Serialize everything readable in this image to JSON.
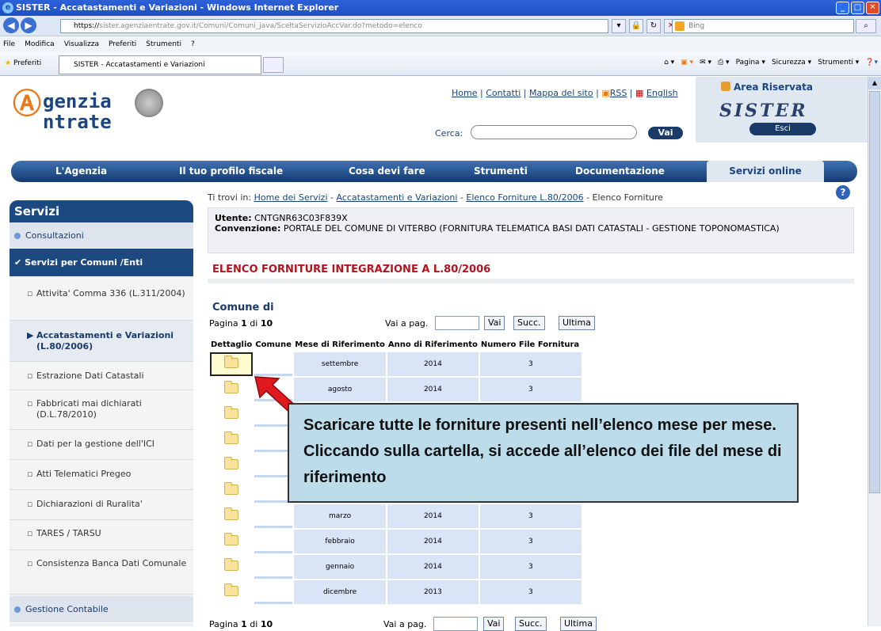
{
  "browser": {
    "title": "SISTER - Accatastamenti e Variazioni - Windows Internet Explorer",
    "url_prefix": "https://",
    "url": "sister.agenziaentrate.gov.it/Comuni/Comuni_java/SceltaServizioAccVar.do?metodo=elenco",
    "search_placeholder": "Bing",
    "menu": [
      "File",
      "Modifica",
      "Visualizza",
      "Preferiti",
      "Strumenti",
      "?"
    ],
    "favorites_label": "Preferiti",
    "tab_title": "SISTER - Accatastamenti e Variazioni",
    "tools": [
      "Pagina ▾",
      "Sicurezza ▾",
      "Strumenti ▾"
    ]
  },
  "header": {
    "logo_line1": "genzia",
    "logo_line2": "ntrate",
    "links": [
      "Home",
      "Contatti",
      "Mappa del sito",
      "RSS",
      "English"
    ],
    "search_label": "Cerca:",
    "search_button": "Vai",
    "area_title": "Area Riservata",
    "area_brand": "SISTER",
    "logout": "Esci"
  },
  "mainnav": [
    "L'Agenzia",
    "Il tuo profilo fiscale",
    "Cosa devi fare",
    "Strumenti",
    "Documentazione",
    "Servizi online"
  ],
  "sidebar": {
    "title": "Servizi",
    "consultazioni": "Consultazioni",
    "servizi_comuni": "Servizi per Comuni /Enti",
    "items": [
      "Attivita' Comma 336 (L.311/2004)",
      "Accatastamenti e Variazioni (L.80/2006)",
      "Estrazione Dati Catastali",
      "Fabbricati mai dichiarati (D.L.78/2010)",
      "Dati per la gestione dell'ICI",
      "Atti Telematici Pregeo",
      "Dichiarazioni di Ruralita'",
      "TARES / TARSU",
      "Consistenza Banca Dati Comunale"
    ],
    "gestione": "Gestione Contabile"
  },
  "breadcrumb": {
    "prefix": "Ti trovi in:",
    "links": [
      "Home dei Servizi",
      "Accatastamenti e Variazioni",
      "Elenco Forniture L.80/2006"
    ],
    "current": "Elenco Forniture"
  },
  "user": {
    "utente_label": "Utente:",
    "utente": "CNTGNR63C03F839X",
    "convenzione_label": "Convenzione:",
    "convenzione": "PORTALE DEL COMUNE DI VITERBO (FORNITURA TELEMATICA BASI DATI CATASTALI - GESTIONE TOPONOMASTICA)"
  },
  "page": {
    "title": "ELENCO FORNITURE INTEGRAZIONE A L.80/2006",
    "comune_label": "Comune di",
    "pagina_label": "Pagina",
    "page_current": "1",
    "di_label": "di",
    "page_total": "10",
    "vai_pag_label": "Vai a pag.",
    "btn_vai": "Vai",
    "btn_succ": "Succ.",
    "btn_ultima": "Ultima"
  },
  "table": {
    "headers": [
      "Dettaglio",
      "Comune",
      "Mese di Riferimento",
      "Anno di Riferimento",
      "Numero File Fornitura"
    ],
    "rows": [
      {
        "mese": "settembre",
        "anno": "2014",
        "num": "3"
      },
      {
        "mese": "agosto",
        "anno": "2014",
        "num": "3"
      },
      {
        "mese": "",
        "anno": "",
        "num": ""
      },
      {
        "mese": "",
        "anno": "",
        "num": ""
      },
      {
        "mese": "",
        "anno": "",
        "num": ""
      },
      {
        "mese": "",
        "anno": "",
        "num": ""
      },
      {
        "mese": "marzo",
        "anno": "2014",
        "num": "3"
      },
      {
        "mese": "febbraio",
        "anno": "2014",
        "num": "3"
      },
      {
        "mese": "gennaio",
        "anno": "2014",
        "num": "3"
      },
      {
        "mese": "dicembre",
        "anno": "2013",
        "num": "3"
      }
    ]
  },
  "callout": "Scaricare tutte le forniture presenti nell’elenco mese per mese. Cliccando sulla cartella, si accede all’elenco dei file del mese di riferimento"
}
